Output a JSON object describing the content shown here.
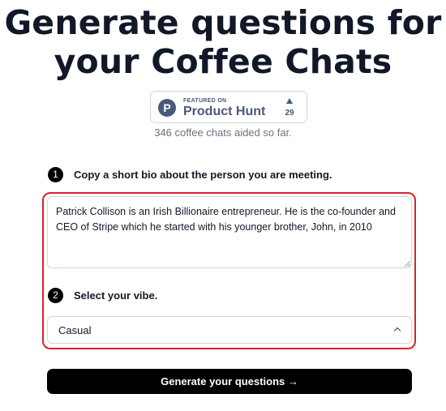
{
  "headline": {
    "line1": "Generate questions for",
    "line2": "your Coffee Chats"
  },
  "product_hunt": {
    "logo_letter": "P",
    "featured": "FEATURED ON",
    "name": "Product Hunt",
    "votes": "29",
    "color": "#4b587c"
  },
  "stats": "346 coffee chats aided so far.",
  "step1": {
    "number": "1",
    "label": "Copy a short bio about the person you are meeting.",
    "bio_line1": "Patrick Collison is an Irish Billionaire entrepreneur. He is the co-founder and",
    "bio_line2": "CEO of Stripe which he started with his younger brother, John, in 2010"
  },
  "step2": {
    "number": "2",
    "label": "Select your vibe.",
    "selected": "Casual"
  },
  "generate_button": "Generate your questions →",
  "colors": {
    "accent": "#000000",
    "highlight": "#d9232e"
  }
}
